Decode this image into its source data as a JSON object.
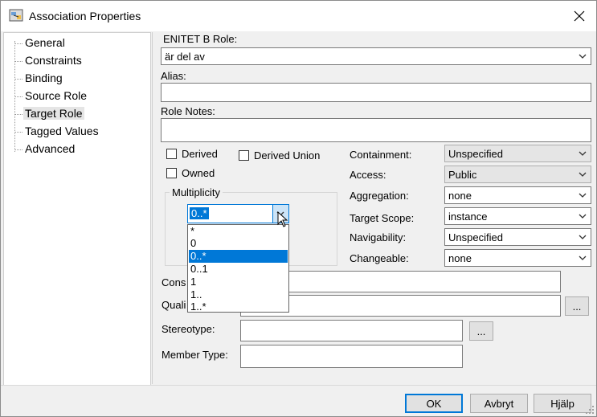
{
  "window": {
    "title": "Association Properties"
  },
  "tree": {
    "items": [
      {
        "label": "General"
      },
      {
        "label": "Constraints"
      },
      {
        "label": "Binding"
      },
      {
        "label": "Source Role"
      },
      {
        "label": "Target Role",
        "selected": true
      },
      {
        "label": "Tagged Values"
      },
      {
        "label": "Advanced"
      }
    ]
  },
  "role": {
    "label": "ENITET B Role:",
    "value": "är del av"
  },
  "alias": {
    "label": "Alias:",
    "value": ""
  },
  "notes": {
    "label": "Role Notes:",
    "value": ""
  },
  "checks": {
    "derived": {
      "label": "Derived",
      "checked": false
    },
    "derived_union": {
      "label": "Derived Union",
      "checked": false
    },
    "owned": {
      "label": "Owned",
      "checked": false
    }
  },
  "multiplicity": {
    "legend": "Multiplicity",
    "value": "0..*",
    "options": [
      "*",
      "0",
      "0..*",
      "0..1",
      "1",
      "1..",
      "1..*"
    ],
    "selected_index": 2
  },
  "props": [
    {
      "label": "Containment:",
      "value": "Unspecified",
      "readonly": true
    },
    {
      "label": "Access:",
      "value": "Public",
      "readonly": true
    },
    {
      "label": "Aggregation:",
      "value": "none",
      "readonly": false
    },
    {
      "label": "Target Scope:",
      "value": "instance",
      "readonly": false
    },
    {
      "label": "Navigability:",
      "value": "Unspecified",
      "readonly": false
    },
    {
      "label": "Changeable:",
      "value": "none",
      "readonly": false
    }
  ],
  "constraints": {
    "label": "Cons",
    "value": ""
  },
  "qualifiers": {
    "label": "Quali",
    "browse": "..."
  },
  "stereotype": {
    "label": "Stereotype:",
    "browse": "..."
  },
  "member_type": {
    "label": "Member Type:"
  },
  "buttons": {
    "ok": "OK",
    "cancel": "Avbryt",
    "help": "Hjälp"
  }
}
